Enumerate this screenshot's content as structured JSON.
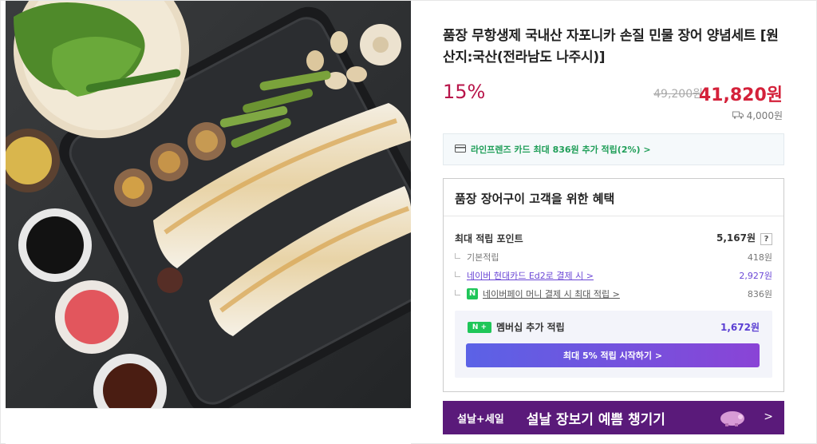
{
  "product": {
    "title": "품장 무항생제 국내산 자포니카 손질 민물 장어 양념세트 [원산지:국산(전라남도 나주시)]",
    "discount": "15%",
    "original_price": "49,200원",
    "price": "41,820원",
    "shipping": "4,000원"
  },
  "card_promo": {
    "text": "라인프렌즈 카드 최대 836원 추가 적립(2%) >"
  },
  "benefits": {
    "heading": "품장 장어구이 고객을 위한 혜택",
    "max_points_label": "최대 적립 포인트",
    "max_points_value": "5,167원",
    "question": "?",
    "base_label": "기본적립",
    "base_value": "418원",
    "hyundai_label": "네이버 현대카드 Ed2로 결제 시 >",
    "hyundai_value": "2,927원",
    "npay_badge": "N",
    "npay_label": "네이버페이 머니 결제 시 최대 적립 >",
    "npay_value": "836원",
    "member_badge": "N +",
    "member_label": "멤버십 추가 적립",
    "member_value": "1,672원",
    "cta_label": "최대 5% 적립 시작하기 >"
  },
  "banner": {
    "tag": "설날+세일",
    "text": "설날 장보기 예쁨 챙기기",
    "chevron": ">"
  },
  "icons": {
    "ship": "truck-icon",
    "card": "card-icon"
  },
  "colors": {
    "discount": "#b8154a",
    "price": "#d4213a",
    "accent_green": "#1fc659",
    "banner": "#5a1a7a"
  }
}
